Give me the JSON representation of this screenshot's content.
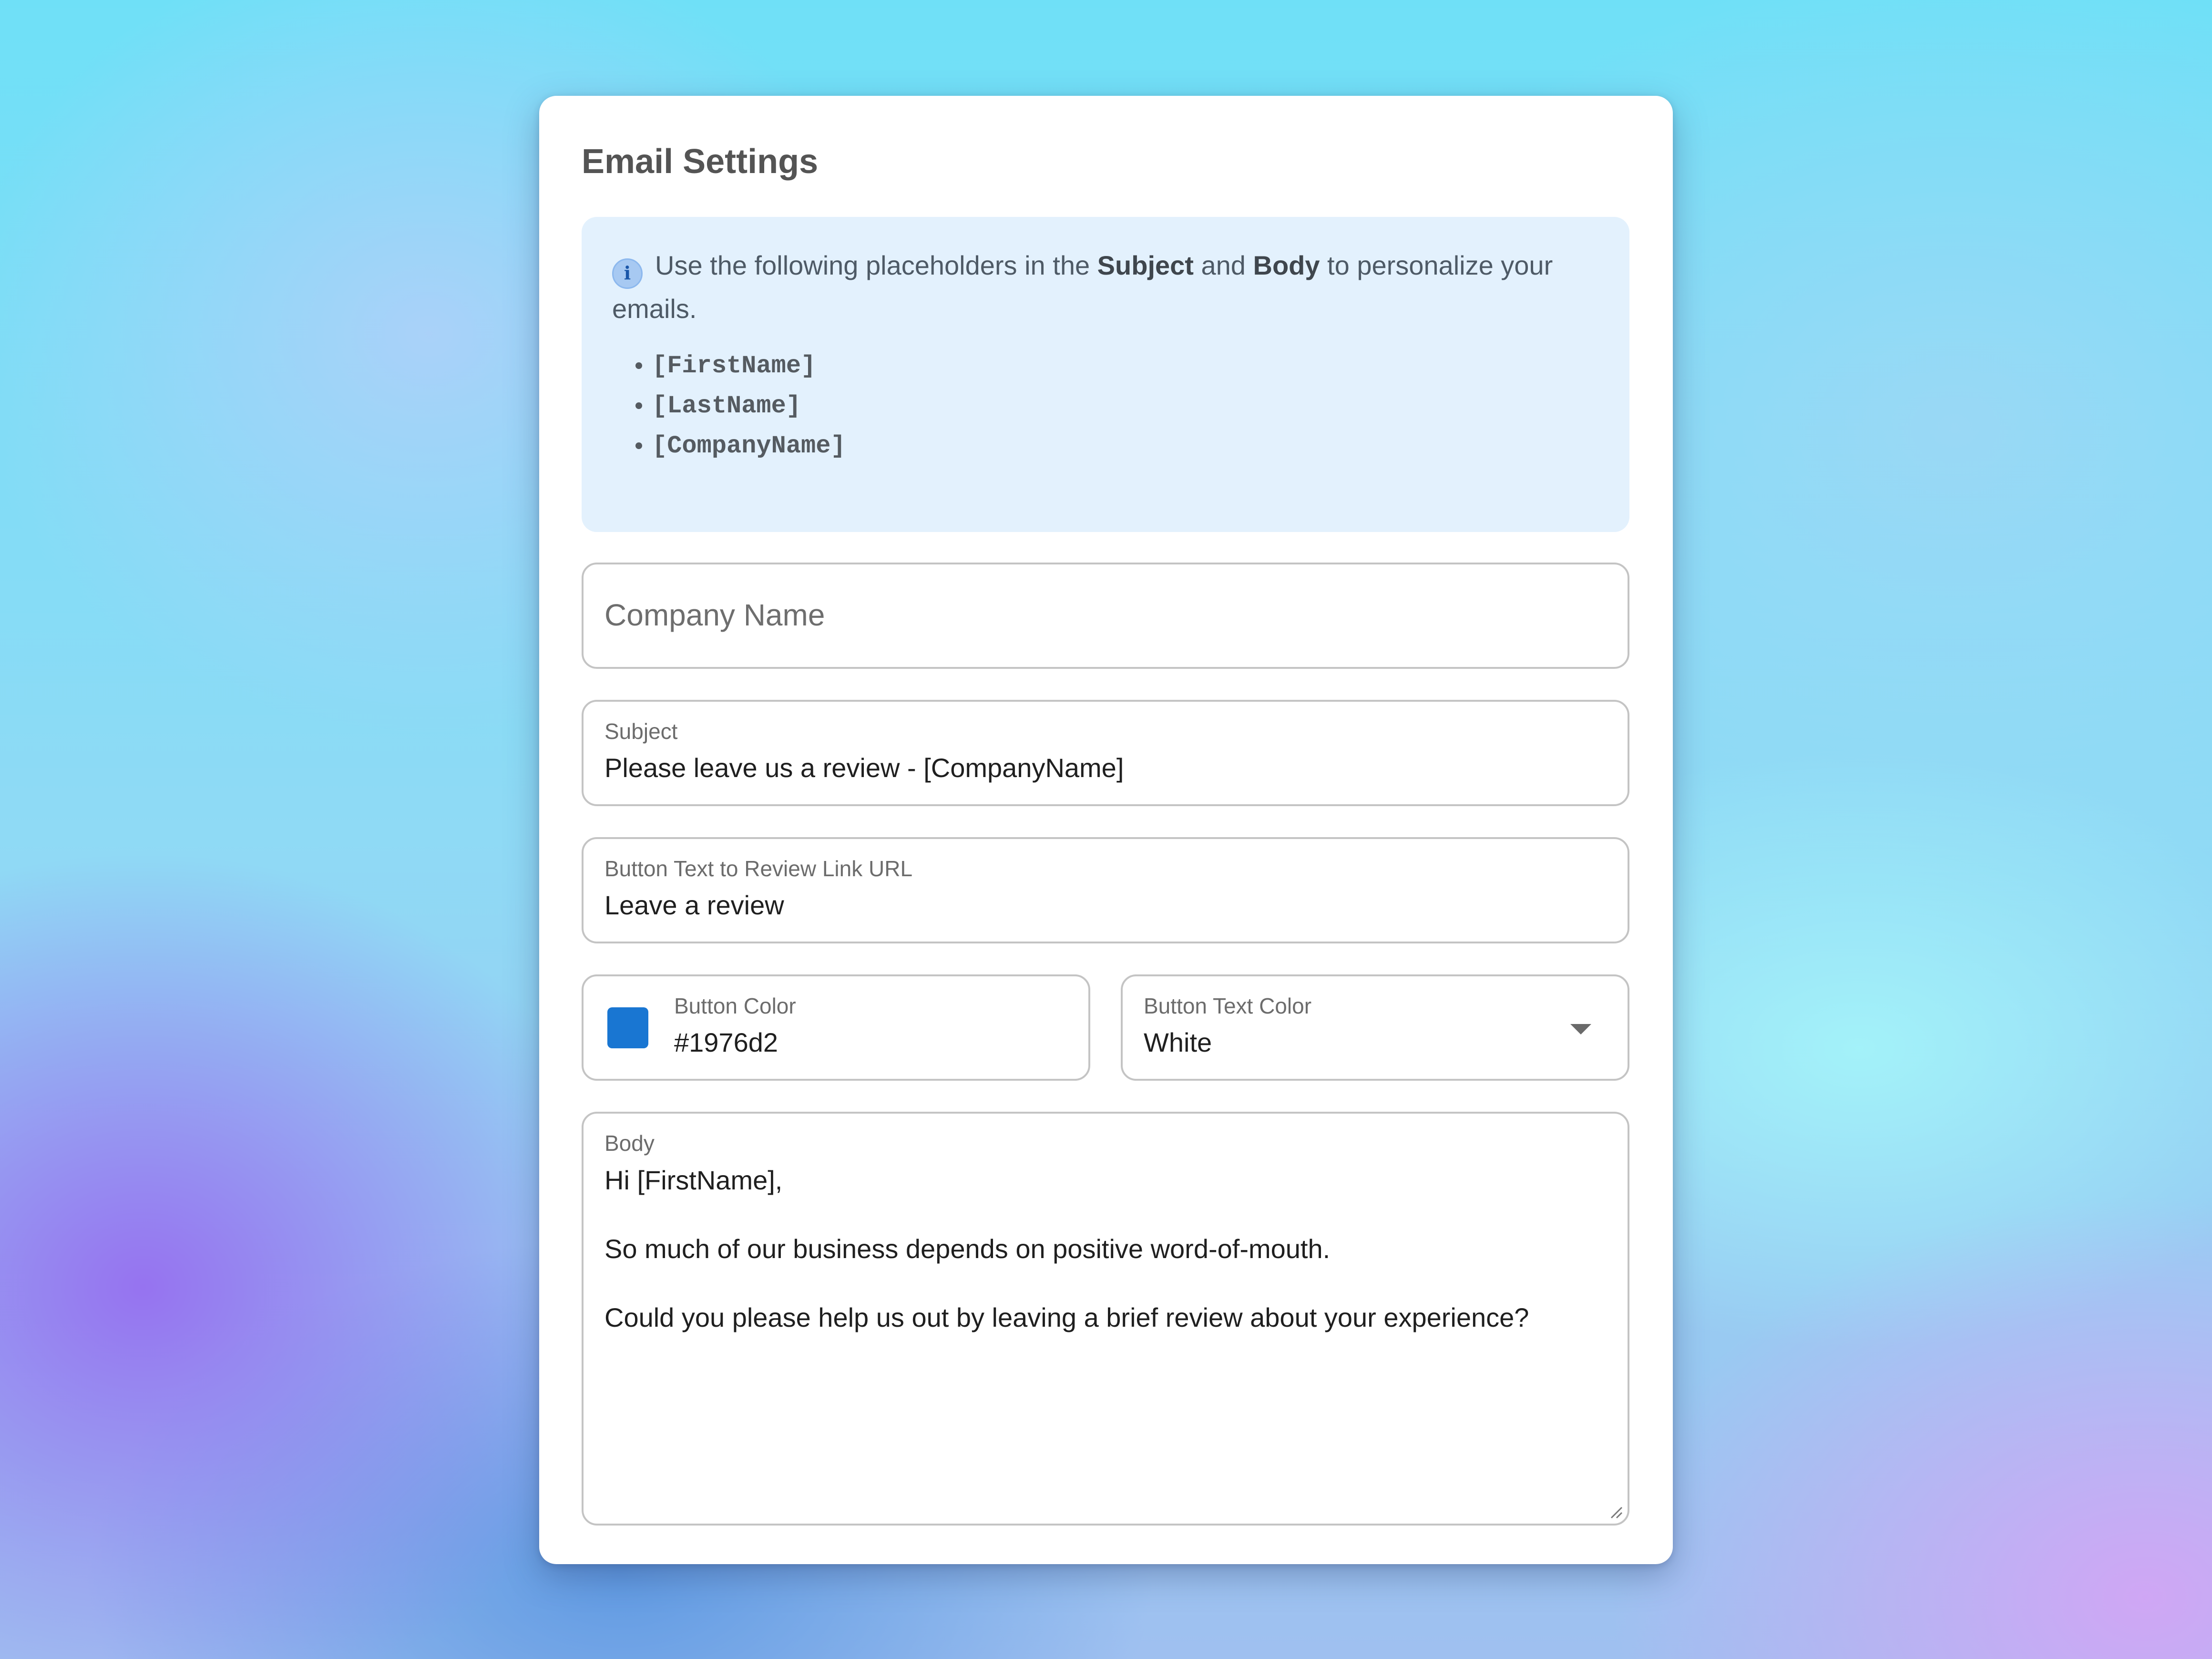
{
  "card": {
    "title": "Email Settings"
  },
  "info": {
    "icon": "info-icon",
    "text_before": "Use the following placeholders in the ",
    "bold_subject": "Subject",
    "text_and": " and ",
    "bold_body": "Body",
    "text_after": " to personalize your emails.",
    "placeholders": [
      "[FirstName]",
      "[LastName]",
      "[CompanyName]"
    ]
  },
  "company_name": {
    "placeholder": "Company Name",
    "value": ""
  },
  "subject": {
    "label": "Subject",
    "value": "Please leave us a review - [CompanyName]"
  },
  "button_text": {
    "label": "Button Text to Review Link URL",
    "value": "Leave a review"
  },
  "button_color": {
    "label": "Button Color",
    "value": "#1976d2",
    "swatch_color": "#1976d2"
  },
  "button_text_color": {
    "label": "Button Text Color",
    "value": "White",
    "icon": "chevron-down-icon"
  },
  "body": {
    "label": "Body",
    "value": "Hi [FirstName],\n\nSo much of our business depends on positive word-of-mouth.\n\nCould you please help us out by leaving a brief review about your experience?"
  },
  "colors": {
    "info_bg": "#e3f1fd",
    "field_border": "#c4c4c4",
    "card_bg": "#ffffff"
  }
}
